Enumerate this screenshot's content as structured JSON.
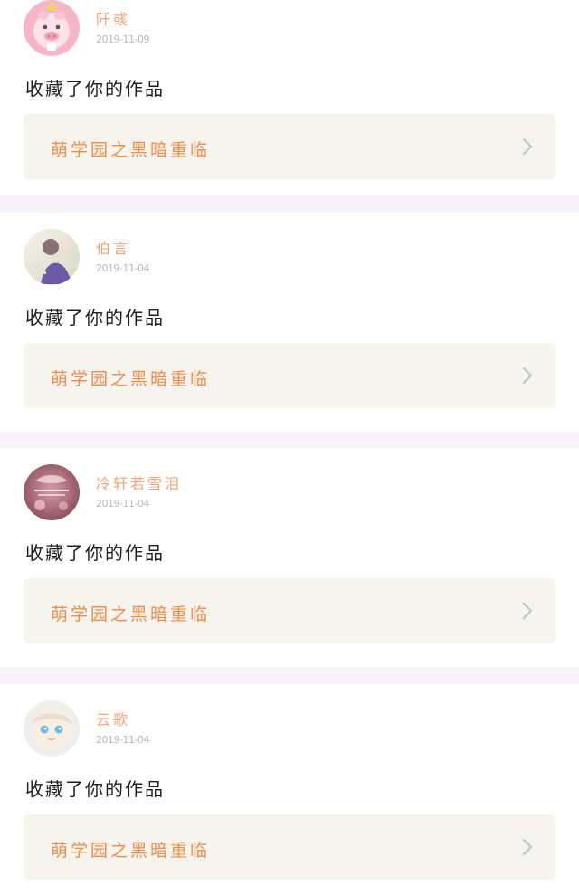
{
  "feed": {
    "items": [
      {
        "username": "阡彧",
        "date": "2019-11-09",
        "action": "收藏了你的作品",
        "work_title": "萌学园之黑暗重临"
      },
      {
        "username": "伯言",
        "date": "2019-11-04",
        "action": "收藏了你的作品",
        "work_title": "萌学园之黑暗重临"
      },
      {
        "username": "冷轩若雪泪",
        "date": "2019-11-04",
        "action": "收藏了你的作品",
        "work_title": "萌学园之黑暗重临"
      },
      {
        "username": "云歌",
        "date": "2019-11-04",
        "action": "收藏了你的作品",
        "work_title": "萌学园之黑暗重临"
      }
    ]
  },
  "colors": {
    "username": "#f0a57a",
    "work_title": "#f08c4a",
    "work_card_bg": "#f5f4ee",
    "separator": "#f6f4f6",
    "date": "#b8b8b8",
    "text": "#1f1f1f"
  },
  "icons": {
    "chevron": "chevron-right-icon"
  }
}
